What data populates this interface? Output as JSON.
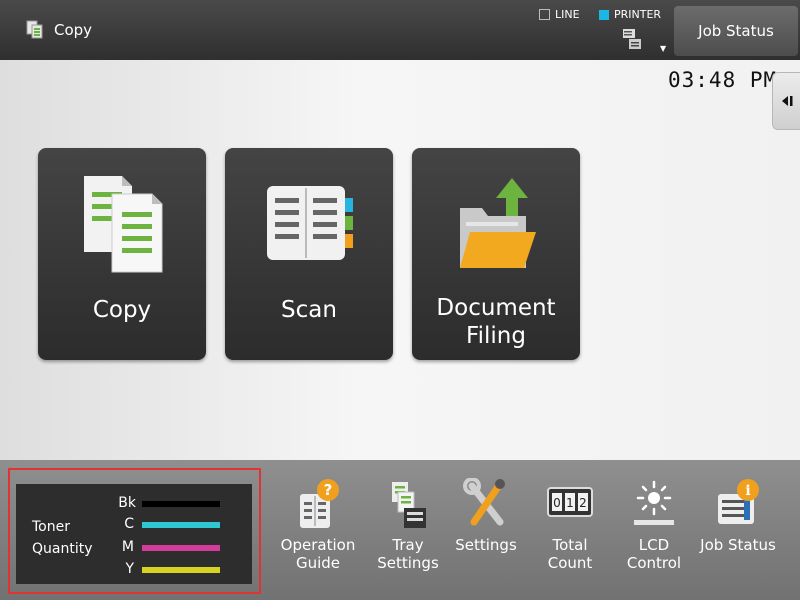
{
  "header": {
    "mode_label": "Copy",
    "indicators": [
      {
        "label": "LINE",
        "color": "#f2f2f2"
      },
      {
        "label": "PRINTER",
        "color": "#19b6e6"
      }
    ],
    "job_status_label": "Job Status"
  },
  "clock": "03:48 PM",
  "tiles": [
    {
      "label": "Copy",
      "icon": "copy-documents-icon"
    },
    {
      "label": "Scan",
      "icon": "scan-book-icon"
    },
    {
      "label": "Document",
      "label2": "Filing",
      "icon": "folder-upload-icon"
    }
  ],
  "toner": {
    "title_line1": "Toner",
    "title_line2": "Quantity",
    "levels": [
      {
        "label": "Bk",
        "color": "#000000"
      },
      {
        "label": "C",
        "color": "#2fc8d2"
      },
      {
        "label": "M",
        "color": "#d43c9c"
      },
      {
        "label": "Y",
        "color": "#d8d321"
      }
    ]
  },
  "functions": [
    {
      "line1": "Operation",
      "line2": "Guide",
      "icon": "operation-guide-icon"
    },
    {
      "line1": "Tray",
      "line2": "Settings",
      "icon": "tray-settings-icon"
    },
    {
      "line1": "Settings",
      "line2": "",
      "icon": "settings-tools-icon"
    },
    {
      "line1": "Total",
      "line2": "Count",
      "icon": "total-count-icon"
    },
    {
      "line1": "LCD",
      "line2": "Control",
      "icon": "lcd-brightness-icon"
    },
    {
      "line1": "Job Status",
      "line2": "",
      "icon": "job-status-icon"
    }
  ]
}
